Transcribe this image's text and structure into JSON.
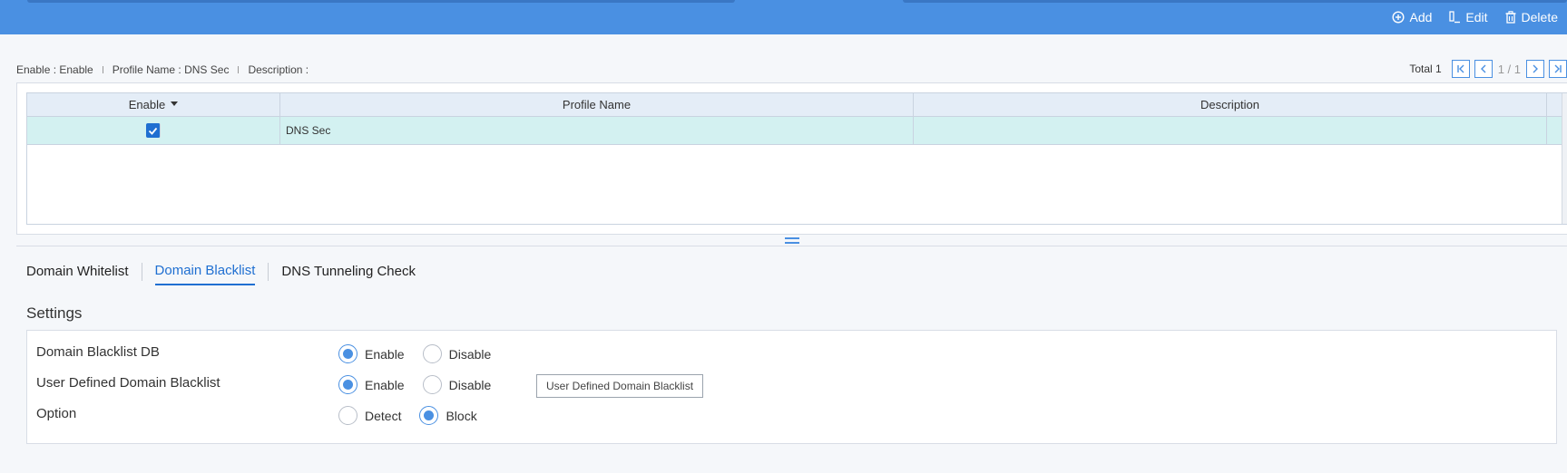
{
  "toolbar": {
    "add_label": "Add",
    "edit_label": "Edit",
    "delete_label": "Delete",
    "icons": {
      "add": "plus-circle-icon",
      "edit": "edit-icon",
      "delete": "trash-icon"
    }
  },
  "summary": {
    "enable": "Enable : Enable",
    "profile_name": "Profile Name : DNS Sec",
    "description": "Description :"
  },
  "pager": {
    "total": "Total 1",
    "page_info": "1 / 1"
  },
  "grid": {
    "columns": [
      "Enable",
      "Profile Name",
      "Description"
    ],
    "rows": [
      {
        "enabled": true,
        "profile_name": "DNS Sec",
        "description": ""
      }
    ]
  },
  "tabs": [
    {
      "label": "Domain Whitelist",
      "active": false
    },
    {
      "label": "Domain Blacklist",
      "active": true
    },
    {
      "label": "DNS Tunneling Check",
      "active": false
    }
  ],
  "settings": {
    "title": "Settings",
    "rows": [
      {
        "label": "Domain Blacklist DB",
        "options": [
          "Enable",
          "Disable"
        ],
        "selected": "Enable"
      },
      {
        "label": "User Defined Domain Blacklist",
        "options": [
          "Enable",
          "Disable"
        ],
        "selected": "Enable",
        "button": "User Defined Domain Blacklist"
      },
      {
        "label": "Option",
        "options": [
          "Detect",
          "Block"
        ],
        "selected": "Block"
      }
    ]
  },
  "colors": {
    "topbar": "#4a90e2",
    "accent": "#1f6fd1",
    "row_selected": "#d3f1f1",
    "header_bg": "#e4edf7"
  }
}
